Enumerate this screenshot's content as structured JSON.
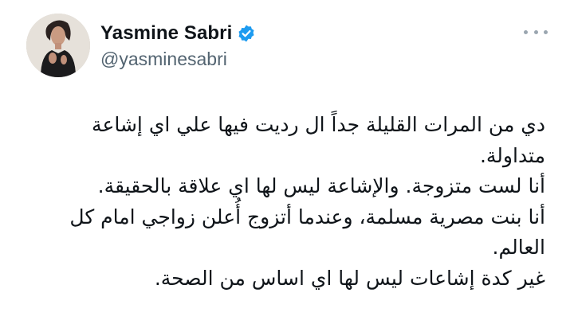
{
  "tweet": {
    "author": {
      "display_name": "Yasmine Sabri",
      "handle": "@yasminesabri",
      "verified": true,
      "verified_color": "#1d9bf0"
    },
    "more_icon": "more-horizontal-icon",
    "text_lines": [
      "دي من المرات القليلة جداً ال رديت فيها علي اي إشاعة",
      "متداولة.",
      "أنا لست متزوجة. والإشاعة ليس لها اي علاقة بالحقيقة.",
      "أنا بنت مصرية مسلمة، وعندما أتزوج أُعلن زواجي امام كل",
      "العالم.",
      "غير كدة إشاعات ليس لها اي اساس من الصحة."
    ]
  }
}
